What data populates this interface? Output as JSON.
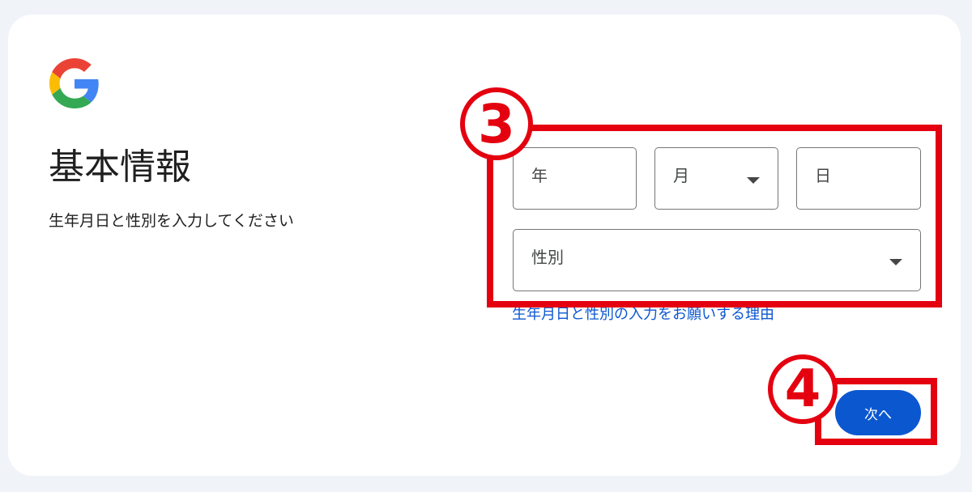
{
  "page": {
    "title": "基本情報",
    "subtitle": "生年月日と性別を入力してください"
  },
  "form": {
    "year_placeholder": "年",
    "month_placeholder": "月",
    "day_placeholder": "日",
    "gender_placeholder": "性別",
    "reason_link": "生年月日と性別の入力をお願いする理由"
  },
  "buttons": {
    "next_label": "次へ"
  },
  "annotations": {
    "marker_3": "3",
    "marker_4": "4"
  },
  "colors": {
    "accent": "#0b57d0",
    "highlight": "#e4000f",
    "background": "#f0f4f9"
  },
  "icons": {
    "logo": "google-logo-icon",
    "dropdown": "caret-down-icon"
  }
}
